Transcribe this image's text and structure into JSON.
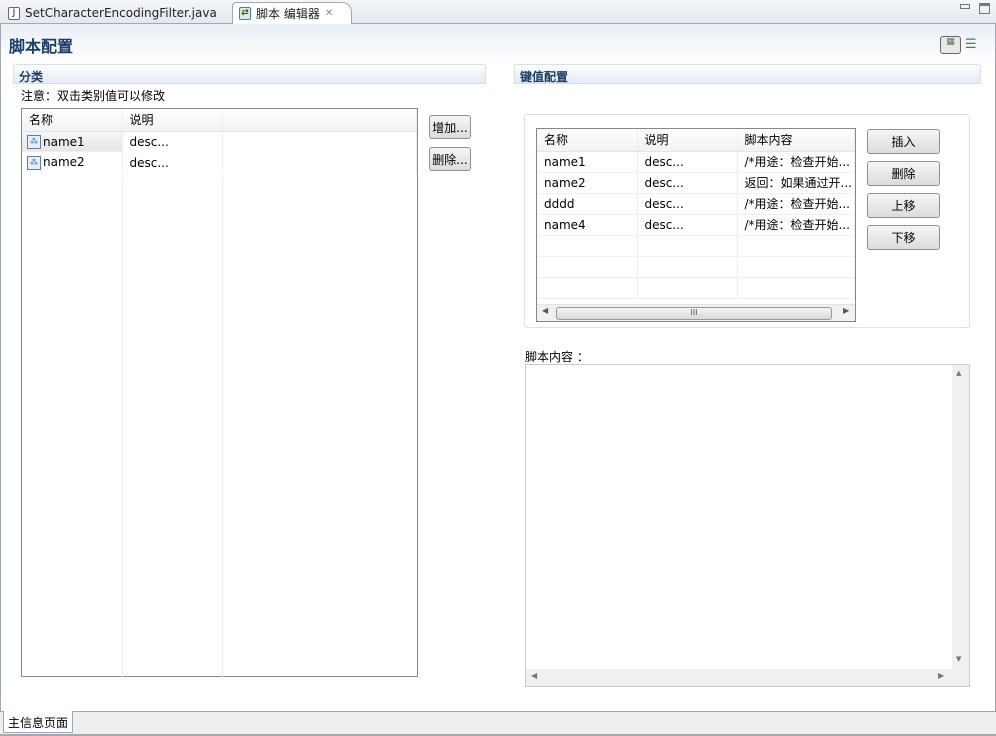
{
  "tabs": [
    {
      "label": "SetCharacterEncodingFilter.java",
      "icon": "java-file-icon"
    },
    {
      "label": "脚本 编辑器",
      "icon": "script-editor-icon",
      "active": true
    }
  ],
  "page_title": "脚本配置",
  "category": {
    "header": "分类",
    "note": "注意：双击类别值可以修改",
    "columns": [
      "名称",
      "说明"
    ],
    "rows": [
      {
        "name": "name1",
        "desc": "desc..."
      },
      {
        "name": "name2",
        "desc": "desc..."
      }
    ],
    "add_label": "增加...",
    "delete_label": "删除..."
  },
  "keyvalue": {
    "header": "键值配置",
    "columns": [
      "名称",
      "说明",
      "脚本内容"
    ],
    "rows": [
      {
        "name": "name1",
        "desc": "desc...",
        "content": "/*用途：检查开始..."
      },
      {
        "name": "name2",
        "desc": "desc...",
        "content": "返回：如果通过开..."
      },
      {
        "name": "dddd",
        "desc": "desc...",
        "content": "/*用途：检查开始..."
      },
      {
        "name": "name4",
        "desc": "desc...",
        "content": "/*用途：检查开始..."
      }
    ],
    "insert_label": "插入",
    "delete_label": "删除",
    "up_label": "上移",
    "down_label": "下移",
    "scroll_grip": "III"
  },
  "script_content": {
    "label": "脚本内容 ：",
    "value": ""
  },
  "bottom_tab": "主信息页面",
  "colors": {
    "title": "#1f3d66",
    "border": "#a0a8b4"
  }
}
